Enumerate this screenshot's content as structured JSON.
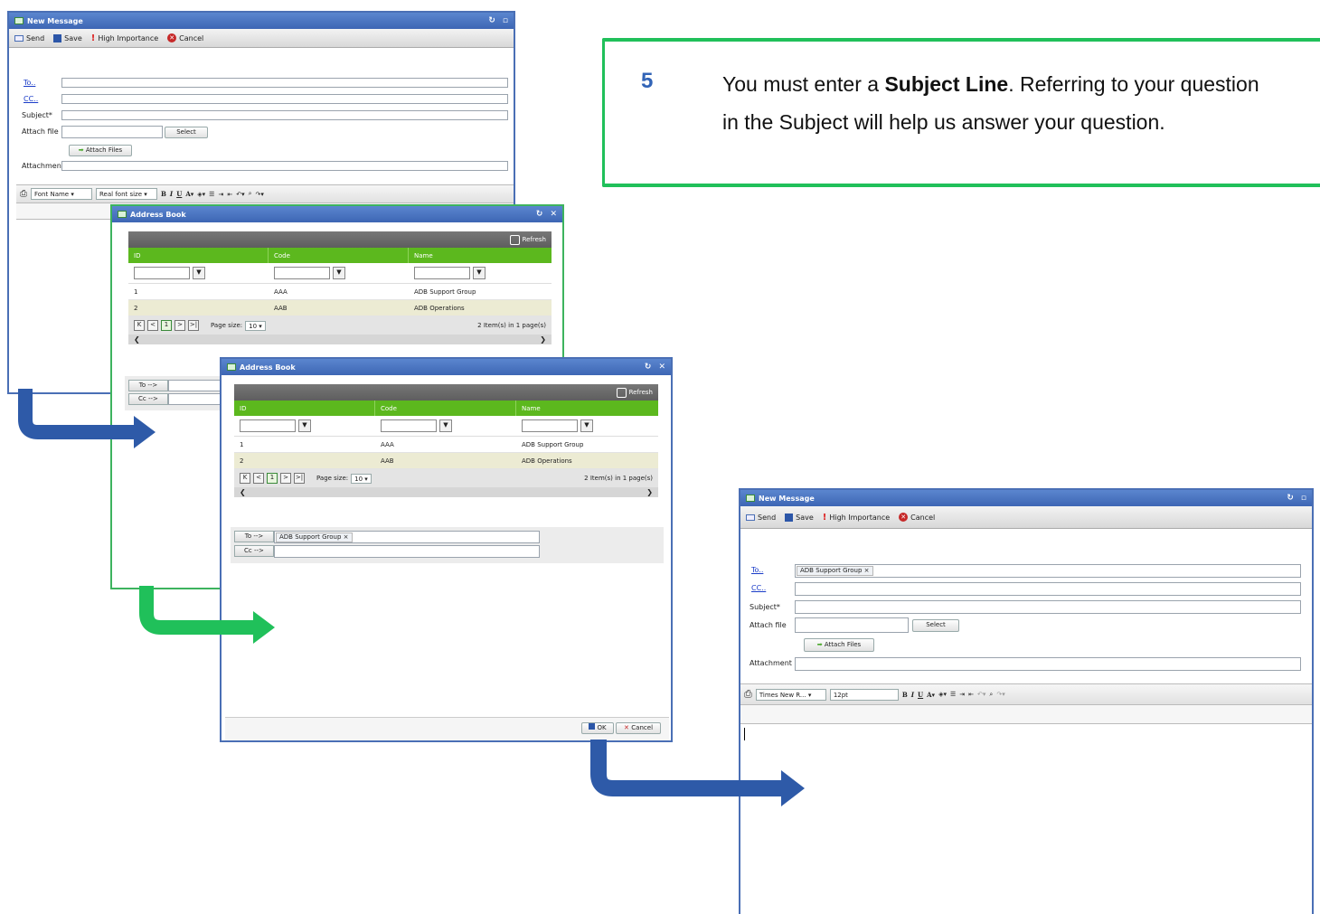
{
  "callout": {
    "number": "5",
    "text_before": "You must enter a ",
    "text_bold": "Subject Line",
    "text_after": ". Referring to your question in the Subject will help us answer your question."
  },
  "colors": {
    "window_blue": "#3d66b4",
    "grid_green": "#5cb81e",
    "callout_green": "#20c05a",
    "arrow_blue": "#2e5aa8",
    "arrow_green": "#20c05a"
  },
  "msg1": {
    "title": "New Message",
    "toolbar": {
      "send": "Send",
      "save": "Save",
      "importance": "High Importance",
      "cancel": "Cancel"
    },
    "form": {
      "to": "To..",
      "cc": "CC..",
      "subject": "Subject*",
      "attach_file": "Attach file",
      "select": "Select",
      "attach_files": "Attach Files",
      "attachment": "Attachment"
    },
    "editor": {
      "font_name": "Font Name",
      "font_size": "Real font size"
    }
  },
  "ab1": {
    "title": "Address Book",
    "refresh": "Refresh",
    "columns": [
      "ID",
      "Code",
      "Name"
    ],
    "rows": [
      {
        "id": "1",
        "code": "AAA",
        "name": "ADB Support Group"
      },
      {
        "id": "2",
        "code": "AAB",
        "name": "ADB Operations"
      }
    ],
    "page": "1",
    "page_size_label": "Page size:",
    "page_size": "10",
    "items_info": "2 Item(s) in 1 page(s)",
    "to_btn": "To -->",
    "cc_btn": "Cc -->"
  },
  "ab2": {
    "title": "Address Book",
    "refresh": "Refresh",
    "columns": [
      "ID",
      "Code",
      "Name"
    ],
    "rows": [
      {
        "id": "1",
        "code": "AAA",
        "name": "ADB Support Group"
      },
      {
        "id": "2",
        "code": "AAB",
        "name": "ADB Operations"
      }
    ],
    "page": "1",
    "page_size_label": "Page size:",
    "page_size": "10",
    "items_info": "2 Item(s) in 1 page(s)",
    "to_btn": "To -->",
    "cc_btn": "Cc -->",
    "to_token": "ADB Support Group",
    "ok": "OK",
    "cancel": "Cancel"
  },
  "msg2": {
    "title": "New Message",
    "toolbar": {
      "send": "Send",
      "save": "Save",
      "importance": "High Importance",
      "cancel": "Cancel"
    },
    "form": {
      "to": "To..",
      "cc": "CC..",
      "subject": "Subject*",
      "attach_file": "Attach file",
      "select": "Select",
      "attach_files": "Attach Files",
      "attachment": "Attachment",
      "to_token": "ADB Support Group"
    },
    "editor": {
      "font_name": "Times New R...",
      "font_size": "12pt"
    }
  }
}
